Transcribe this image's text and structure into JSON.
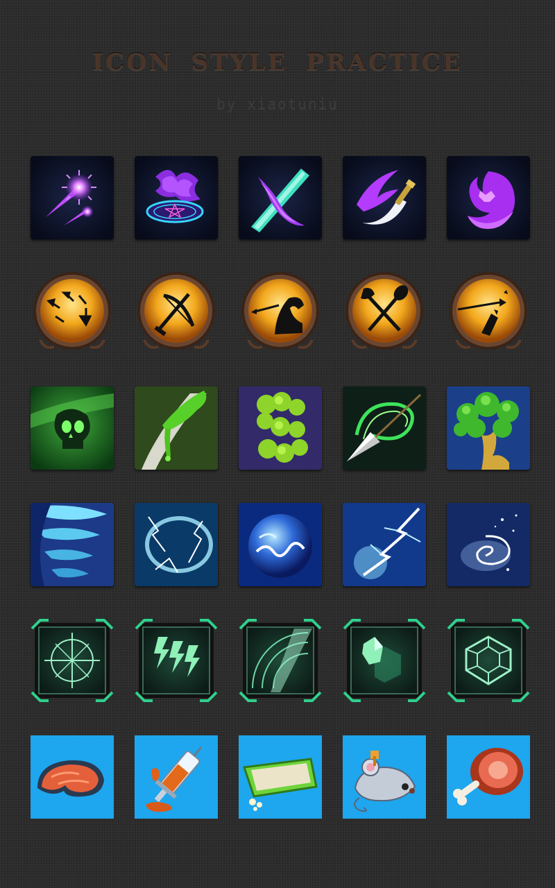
{
  "header": {
    "title": "ICON STYLE PRACTICE",
    "subtitle": "by xiaotuniu"
  },
  "colors": {
    "background": "#2c2c2c",
    "title": "#4a3428",
    "purple_frame": "#0c1226",
    "gold_orb": "#e9a41d",
    "nature_green": "#2f8a2a",
    "ice_blue": "#1d6fc2",
    "tech_green": "#2fd08f",
    "sky_blue": "#1ea6ee"
  },
  "rows": [
    {
      "style": "purple-magic",
      "icons": [
        "star-comet-icon",
        "pentagram-portal-icon",
        "crossed-crystal-blades-icon",
        "scythe-slash-icon",
        "bat-spirit-icon"
      ]
    },
    {
      "style": "golden-orb-emblem",
      "icons": [
        "falling-arrows-icon",
        "sword-bow-crossed-icon",
        "arrow-flex-arm-icon",
        "axe-mace-crossed-icon",
        "arrow-shatter-icon"
      ]
    },
    {
      "style": "green-nature-poison",
      "icons": [
        "poison-skull-icon",
        "venom-blade-icon",
        "toxic-cloud-icon",
        "arrowhead-swirl-icon",
        "tree-of-life-icon"
      ]
    },
    {
      "style": "blue-ice-storm",
      "icons": [
        "whirlwind-icon",
        "lightning-ring-icon",
        "water-orb-icon",
        "lightning-strike-icon",
        "galaxy-spiral-icon"
      ]
    },
    {
      "style": "green-tech-frame",
      "icons": [
        "crosshair-radar-icon",
        "triple-bolt-icon",
        "sonar-sweep-icon",
        "hexagon-crystal-icon",
        "gem-outline-icon"
      ]
    },
    {
      "style": "cartoon-item-blue",
      "icons": [
        "salmon-steak-icon",
        "syringe-potion-icon",
        "litter-box-icon",
        "wind-up-mouse-icon",
        "ham-leg-icon"
      ]
    }
  ]
}
